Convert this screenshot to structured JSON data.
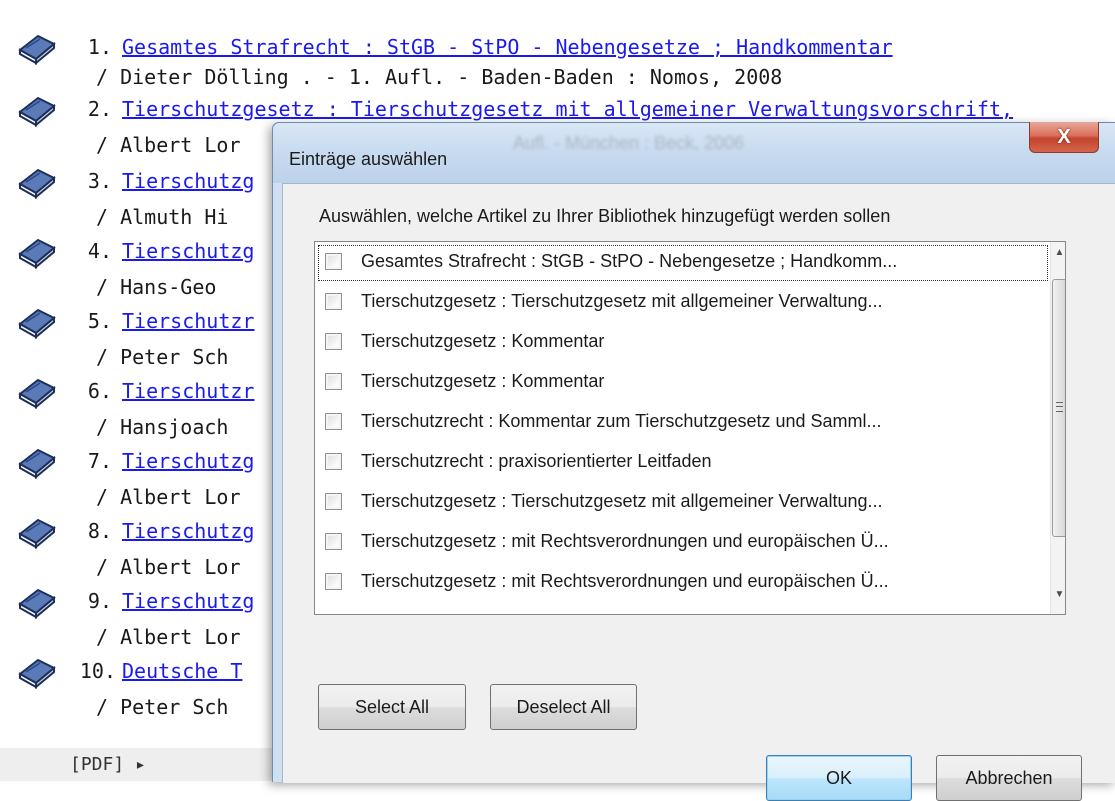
{
  "results": [
    {
      "num": "1.",
      "title": "Gesamtes Strafrecht : StGB - StPO - Nebengesetze ; Handkommentar",
      "author": "/ Dieter Dölling . - 1. Aufl. - Baden-Baden : Nomos, 2008"
    },
    {
      "num": "2.",
      "title": "Tierschutzgesetz : Tierschutzgesetz mit allgemeiner Verwaltungsvorschrift,",
      "author": "/ Albert Lor"
    },
    {
      "num": "3.",
      "title": "Tierschutzg",
      "author": "/ Almuth Hi"
    },
    {
      "num": "4.",
      "title": "Tierschutzg",
      "author": "/ Hans-Geo"
    },
    {
      "num": "5.",
      "title": "Tierschutzr",
      "author": "/ Peter Sch"
    },
    {
      "num": "6.",
      "title": "Tierschutzr",
      "author": "/ Hansjoach"
    },
    {
      "num": "7.",
      "title": "Tierschutzg",
      "author": "/ Albert Lor"
    },
    {
      "num": "8.",
      "title": "Tierschutzg",
      "author": "/ Albert Lor"
    },
    {
      "num": "9.",
      "title": "Tierschutzg",
      "author": "/ Albert Lor"
    },
    {
      "num": "10.",
      "title": "Deutsche T",
      "author": "/ Peter Sch"
    }
  ],
  "bottom_text": "[PDF] ▸",
  "dialog": {
    "title": "Einträge auswählen",
    "ghost_text": "Aufl. - München : Beck, 2006",
    "close_label": "X",
    "instruction": "Auswählen, welche Artikel zu Ihrer Bibliothek hinzugefügt werden sollen",
    "items": [
      {
        "label": "Gesamtes Strafrecht : StGB - StPO - Nebengesetze ; Handkomm...",
        "checked": false
      },
      {
        "label": "Tierschutzgesetz : Tierschutzgesetz mit allgemeiner Verwaltung...",
        "checked": false
      },
      {
        "label": "Tierschutzgesetz : Kommentar",
        "checked": false
      },
      {
        "label": "Tierschutzgesetz : Kommentar",
        "checked": false
      },
      {
        "label": "Tierschutzrecht : Kommentar zum Tierschutzgesetz und Samml...",
        "checked": false
      },
      {
        "label": "Tierschutzrecht : praxisorientierter Leitfaden",
        "checked": false
      },
      {
        "label": "Tierschutzgesetz : Tierschutzgesetz mit allgemeiner Verwaltung...",
        "checked": false
      },
      {
        "label": "Tierschutzgesetz : mit Rechtsverordnungen und europäischen Ü...",
        "checked": false
      },
      {
        "label": "Tierschutzgesetz : mit Rechtsverordnungen und europäischen Ü...",
        "checked": false
      }
    ],
    "select_all_label": "Select All",
    "deselect_all_label": "Deselect All",
    "ok_label": "OK",
    "cancel_label": "Abbrechen"
  },
  "colors": {
    "link": "#1a1aee",
    "close_button": "#c3452e",
    "dialog_frame": "#cfe0f3"
  }
}
